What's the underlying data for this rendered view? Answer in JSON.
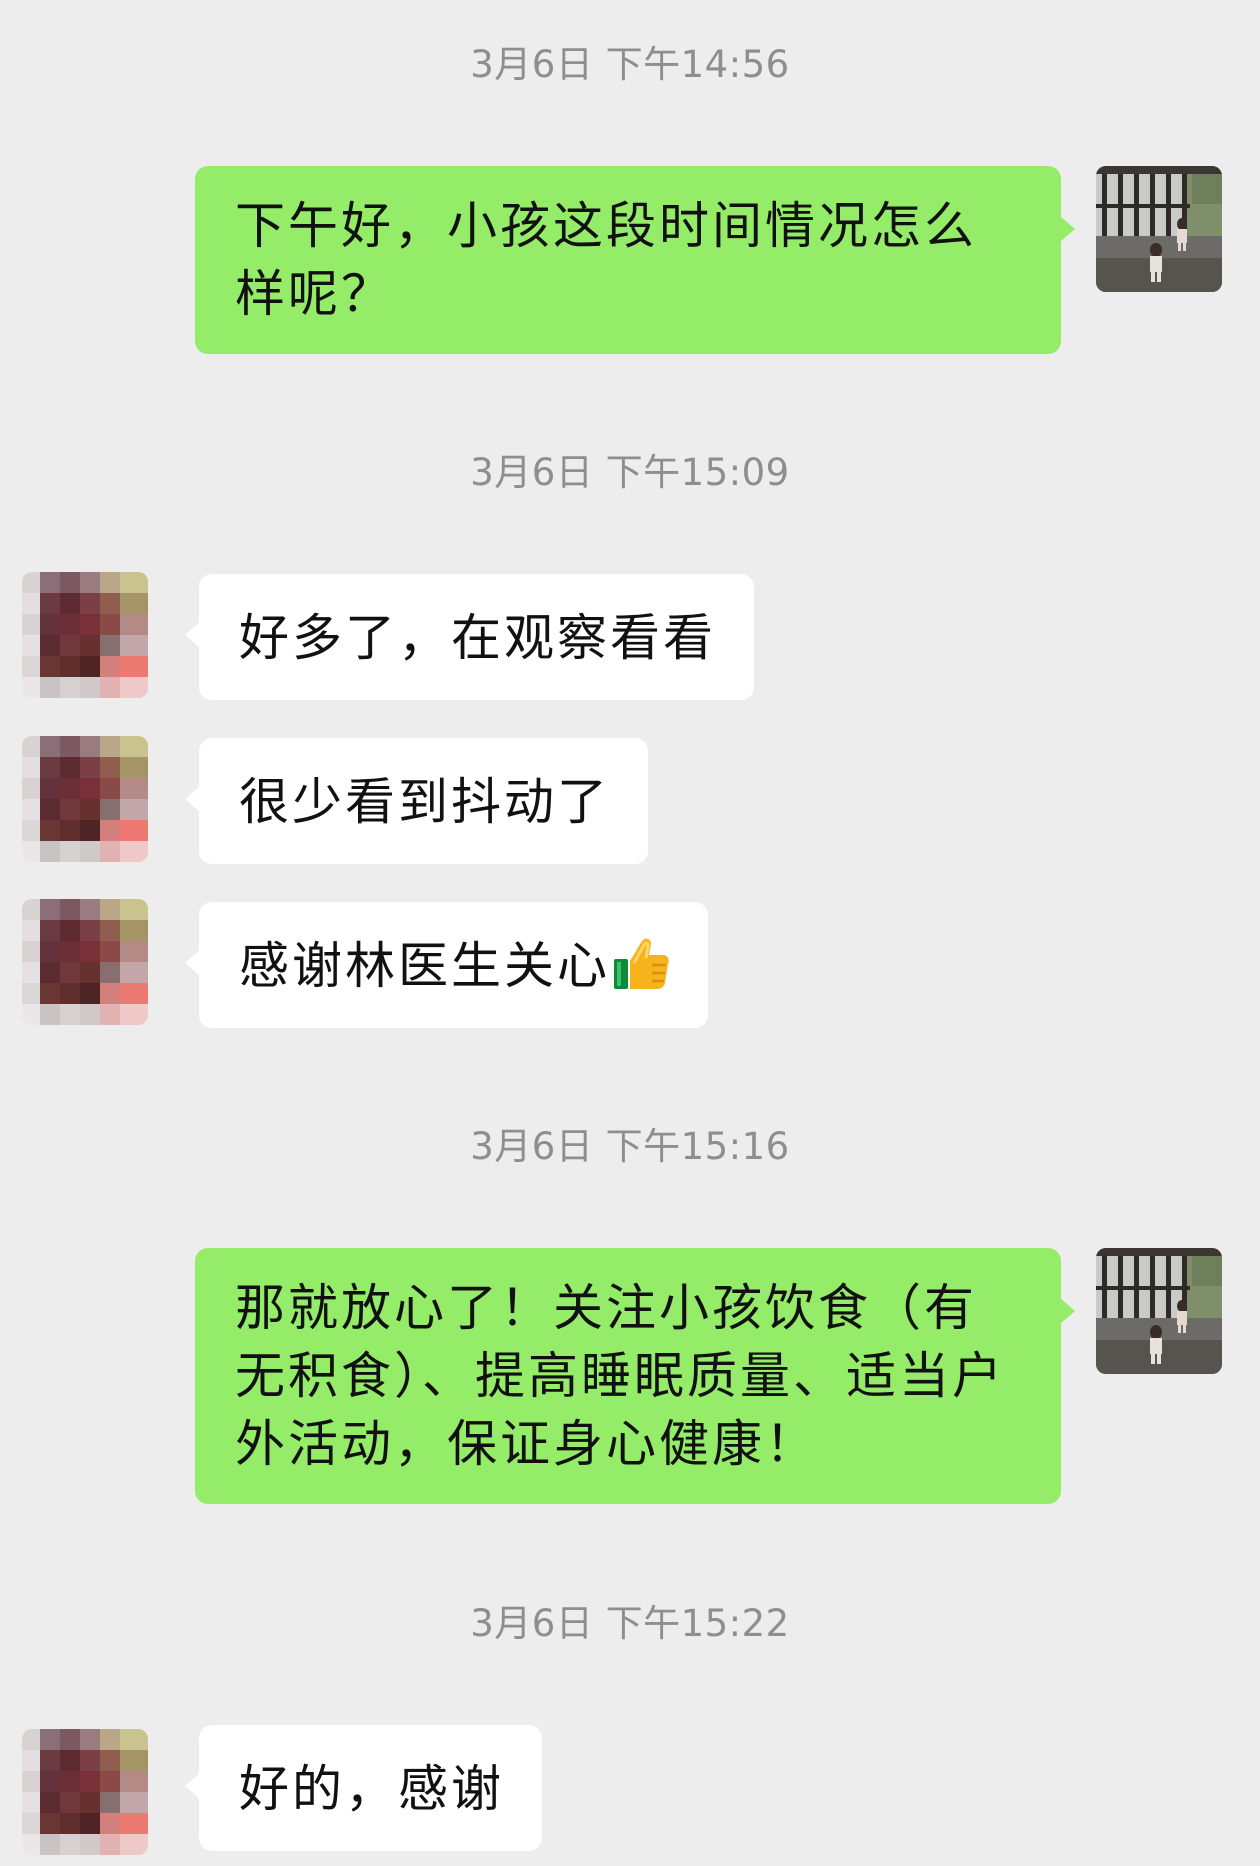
{
  "chat": {
    "times": [
      "3月6日 下午14:56",
      "3月6日 下午15:09",
      "3月6日 下午15:16",
      "3月6日 下午15:22"
    ],
    "messages": {
      "m1": "下午好，小孩这段时间情况怎么样呢？",
      "m2": "好多了，在观察看看",
      "m3": "很少看到抖动了",
      "m4": "感谢林医生关心",
      "m5": "那就放心了！关注小孩饮食（有无积食）、提高睡眠质量、适当户外活动，保证身心健康！",
      "m6": "好的，感谢"
    },
    "emoji": "thumbs-up-icon"
  },
  "colors": {
    "background": "#ededed",
    "outgoing_bubble": "#95ec69",
    "incoming_bubble": "#ffffff",
    "timestamp_text": "#8e8e8e"
  }
}
